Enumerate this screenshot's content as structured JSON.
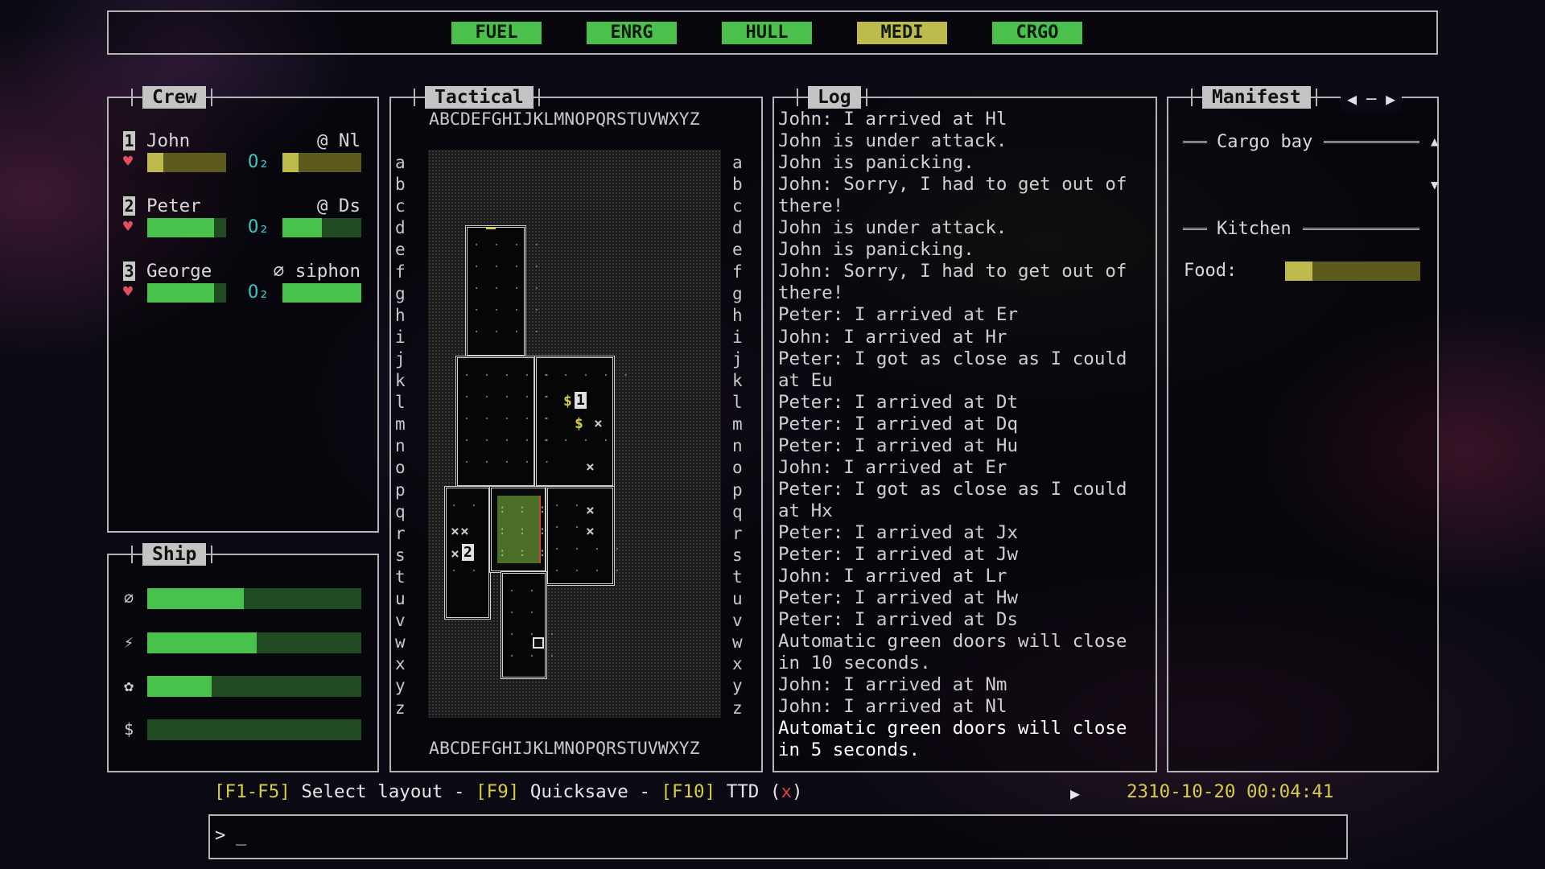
{
  "top_bar": {
    "buttons": [
      {
        "label": "FUEL",
        "color": "#4cc04c"
      },
      {
        "label": "ENRG",
        "color": "#4cc04c"
      },
      {
        "label": "HULL",
        "color": "#4cc04c"
      },
      {
        "label": "MEDI",
        "color": "#bdbb4c"
      },
      {
        "label": "CRGO",
        "color": "#4cc04c"
      }
    ]
  },
  "crew": {
    "title": "Crew",
    "members": [
      {
        "num": "1",
        "name": "John",
        "location": "@ Nl",
        "health": 0.2,
        "o2": 0.2,
        "bar_color": "yellow"
      },
      {
        "num": "2",
        "name": "Peter",
        "location": "@ Ds",
        "health": 0.85,
        "o2": 0.5,
        "bar_color": "green"
      },
      {
        "num": "3",
        "name": "George",
        "location": "⌀ siphon",
        "health": 0.85,
        "o2": 1.0,
        "bar_color": "green"
      }
    ],
    "heart": "♥",
    "o2_label": "O₂"
  },
  "ship": {
    "title": "Ship",
    "stats": [
      {
        "icon": "⌀",
        "icon_name": "siphon-icon",
        "value": 0.45
      },
      {
        "icon": "⚡",
        "icon_name": "energy-icon",
        "value": 0.51
      },
      {
        "icon": "✿",
        "icon_name": "medical-icon",
        "value": 0.3
      },
      {
        "icon": "$",
        "icon_name": "cargo-icon",
        "value": 0.0
      }
    ]
  },
  "tactical": {
    "title": "Tactical",
    "columns": "ABCDEFGHIJKLMNOPQRSTUVWXYZ",
    "rows": [
      "a",
      "b",
      "c",
      "d",
      "e",
      "f",
      "g",
      "h",
      "i",
      "j",
      "k",
      "l",
      "m",
      "n",
      "o",
      "p",
      "q",
      "r",
      "s",
      "t",
      "u",
      "v",
      "w",
      "x",
      "y",
      "z"
    ],
    "crew_marker_1": "1",
    "crew_marker_2": "2",
    "cargo_symbol": "$",
    "debris_symbol": "×"
  },
  "log": {
    "title": "Log",
    "lines": [
      "John: I arrived at Hl",
      "John is under attack.",
      "John is panicking.",
      "John: Sorry, I had to get out of",
      "there!",
      "John is under attack.",
      "John is panicking.",
      "John: Sorry, I had to get out of",
      "there!",
      "Peter: I arrived at Er",
      "John: I arrived at Hr",
      "Peter: I got as close as I could",
      "at Eu",
      "Peter: I arrived at Dt",
      "Peter: I arrived at Dq",
      "Peter: I arrived at Hu",
      "John: I arrived at Er",
      "Peter: I got as close as I could",
      "at Hx",
      "Peter: I arrived at Jx",
      "Peter: I arrived at Jw",
      "John: I arrived at Lr",
      "Peter: I arrived at Hw",
      "Peter: I arrived at Ds",
      "Automatic green doors will close",
      "in 10 seconds.",
      "John: I arrived at Nm",
      "John: I arrived at Nl",
      "Automatic green doors will close",
      "in 5 seconds."
    ]
  },
  "manifest": {
    "title": "Manifest",
    "nav": "◀ ─ ▶",
    "sections": [
      {
        "title": "Cargo bay"
      },
      {
        "title": "Kitchen"
      }
    ],
    "food_label": "Food:",
    "food_level": 0.2,
    "scroll_up": "▲",
    "scroll_down": "▼"
  },
  "status_bar": {
    "k1": "[F1-F5]",
    "t1": " Select layout - ",
    "k2": "[F9]",
    "t2": " Quicksave - ",
    "k3": "[F10]",
    "t3": " TTD (",
    "x": "x",
    "t4": ")",
    "play": "▶",
    "datetime": "2310-10-20 00:04:41"
  },
  "console": {
    "prompt": ">",
    "cursor": "_"
  }
}
